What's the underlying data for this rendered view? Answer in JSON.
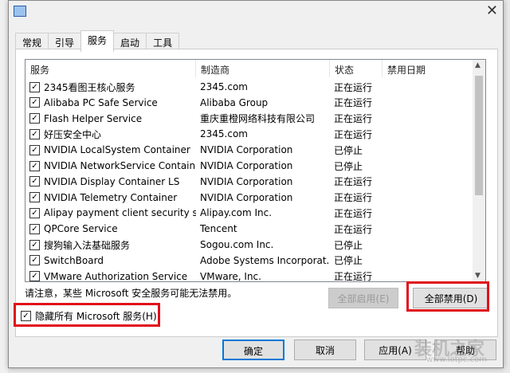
{
  "tabs": [
    "常规",
    "引导",
    "服务",
    "启动",
    "工具"
  ],
  "columns": [
    "服务",
    "制造商",
    "状态",
    "禁用日期"
  ],
  "rows": [
    {
      "name": "2345看图王核心服务",
      "vendor": "2345.com",
      "status": "正在运行"
    },
    {
      "name": "Alibaba PC Safe Service",
      "vendor": "Alibaba Group",
      "status": "正在运行"
    },
    {
      "name": "Flash Helper Service",
      "vendor": "重庆重橙网络科技有限公司",
      "status": "正在运行"
    },
    {
      "name": "好压安全中心",
      "vendor": "2345.com",
      "status": "正在运行"
    },
    {
      "name": "NVIDIA LocalSystem Container",
      "vendor": "NVIDIA Corporation",
      "status": "已停止"
    },
    {
      "name": "NVIDIA NetworkService Container",
      "vendor": "NVIDIA Corporation",
      "status": "已停止"
    },
    {
      "name": "NVIDIA Display Container LS",
      "vendor": "NVIDIA Corporation",
      "status": "正在运行"
    },
    {
      "name": "NVIDIA Telemetry Container",
      "vendor": "NVIDIA Corporation",
      "status": "正在运行"
    },
    {
      "name": "Alipay payment client security ser...",
      "vendor": "Alipay.com Inc.",
      "status": "正在运行"
    },
    {
      "name": "QPCore Service",
      "vendor": "Tencent",
      "status": "正在运行"
    },
    {
      "name": "搜狗输入法基础服务",
      "vendor": "Sogou.com Inc.",
      "status": "已停止"
    },
    {
      "name": "SwitchBoard",
      "vendor": "Adobe Systems Incorporat...",
      "status": "已停止"
    },
    {
      "name": "VMware Authorization Service",
      "vendor": "VMware, Inc.",
      "status": "正在运行"
    }
  ],
  "note": "请注意，某些 Microsoft 安全服务可能无法禁用。",
  "enable_all": "全部启用(E)",
  "disable_all": "全部禁用(D)",
  "hide_ms": "隐藏所有 Microsoft 服务(H)",
  "ok": "确定",
  "cancel": "取消",
  "apply": "应用(A)",
  "help": "帮助",
  "watermark": "装机之家",
  "watermark_url": "www.lotpc.com",
  "close": "✕"
}
